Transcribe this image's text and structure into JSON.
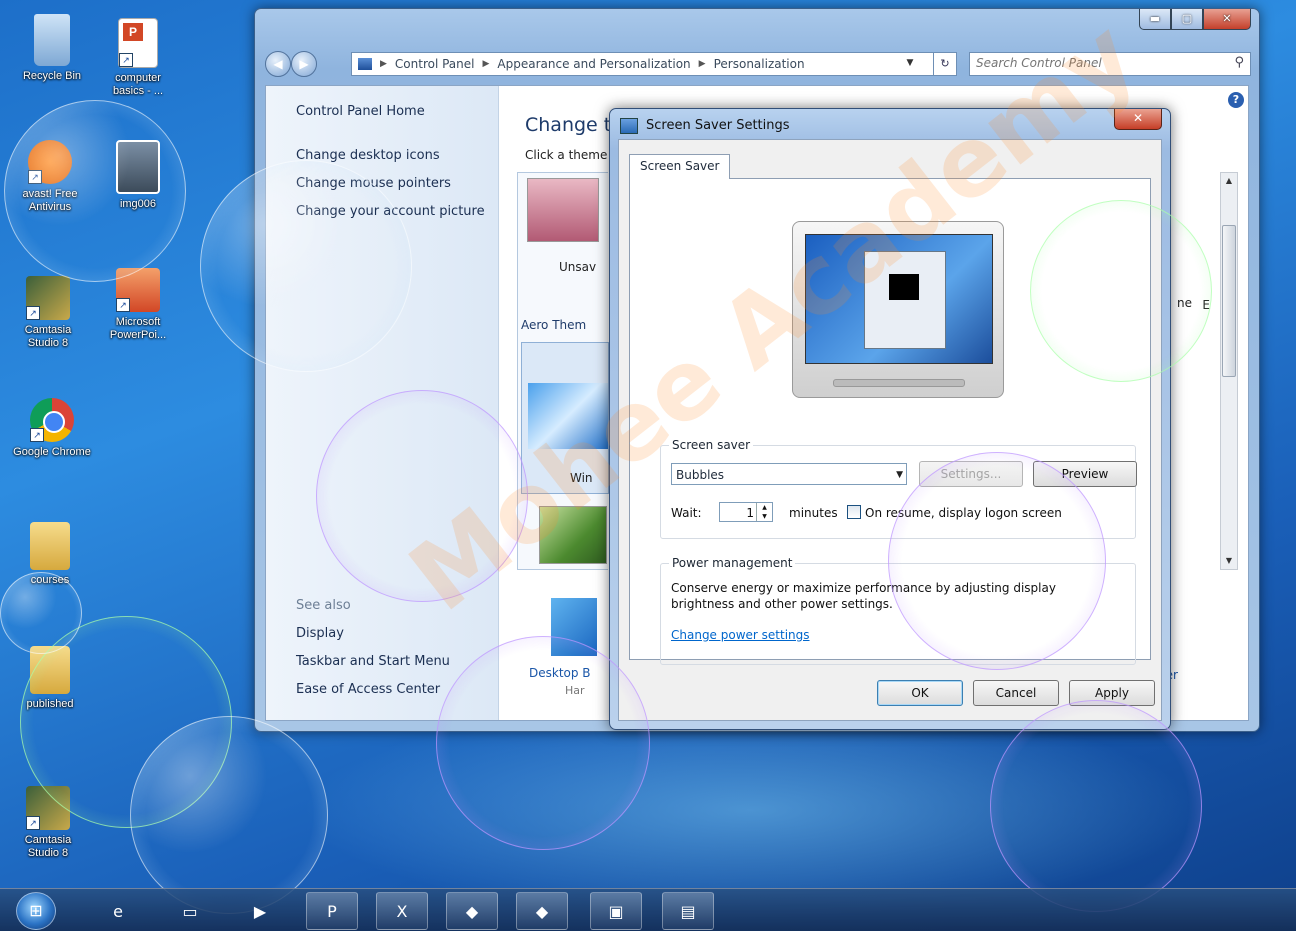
{
  "desktop": {
    "icons": [
      {
        "label": "Recycle Bin",
        "icon": "recycle-bin-icon"
      },
      {
        "label": "computer basics - ...",
        "icon": "powerpoint-file-icon"
      },
      {
        "label": "avast! Free Antivirus",
        "icon": "avast-icon"
      },
      {
        "label": "img006",
        "icon": "image-file-icon"
      },
      {
        "label": "Camtasia Studio 8",
        "icon": "camtasia-icon"
      },
      {
        "label": "Microsoft PowerPoi...",
        "icon": "powerpoint-app-icon"
      },
      {
        "label": "Google Chrome",
        "icon": "chrome-icon"
      },
      {
        "label": "courses",
        "icon": "folder-icon"
      },
      {
        "label": "published",
        "icon": "folder-icon"
      },
      {
        "label": "Camtasia Studio 8",
        "icon": "camtasia-icon"
      }
    ]
  },
  "window": {
    "breadcrumb": [
      "Control Panel",
      "Appearance and Personalization",
      "Personalization"
    ],
    "search_placeholder": "Search Control Panel",
    "left_pane": {
      "home": "Control Panel Home",
      "links": [
        "Change desktop icons",
        "Change mouse pointers",
        "Change your account picture"
      ],
      "see_also": "See also",
      "see_also_links": [
        "Display",
        "Taskbar and Start Menu",
        "Ease of Access Center"
      ]
    },
    "main": {
      "title_partial": "Change th",
      "subtitle_partial": "Click a theme",
      "unsaved_partial": "Unsav",
      "aero_partial": "Aero Them",
      "win_partial": "Win",
      "desktop_bg_partial": "Desktop B",
      "desktop_bg_sub_partial": "Har",
      "right_edge_1": "ne",
      "right_edge_2": "E",
      "right_edge_3": "er"
    }
  },
  "dialog": {
    "title": "Screen Saver Settings",
    "tab": "Screen Saver",
    "screen_saver_label": "Screen saver",
    "selected_saver": "Bubbles",
    "settings_button": "Settings...",
    "preview_button": "Preview",
    "wait_label": "Wait:",
    "wait_value": "1",
    "minutes_label": "minutes",
    "resume_checkbox": "On resume, display logon screen",
    "resume_checked": false,
    "power_title": "Power management",
    "power_text": "Conserve energy or maximize performance by adjusting display brightness and other power settings.",
    "power_link": "Change power settings",
    "ok": "OK",
    "cancel": "Cancel",
    "apply": "Apply"
  },
  "taskbar": {
    "items": [
      "internet-explorer-icon",
      "windows-explorer-icon",
      "media-player-icon",
      "powerpoint-icon",
      "excel-icon",
      "camtasia-recorder-icon",
      "camtasia-studio-icon",
      "control-panel-icon",
      "screen-saver-icon"
    ]
  },
  "watermark": "Mohee Academy"
}
